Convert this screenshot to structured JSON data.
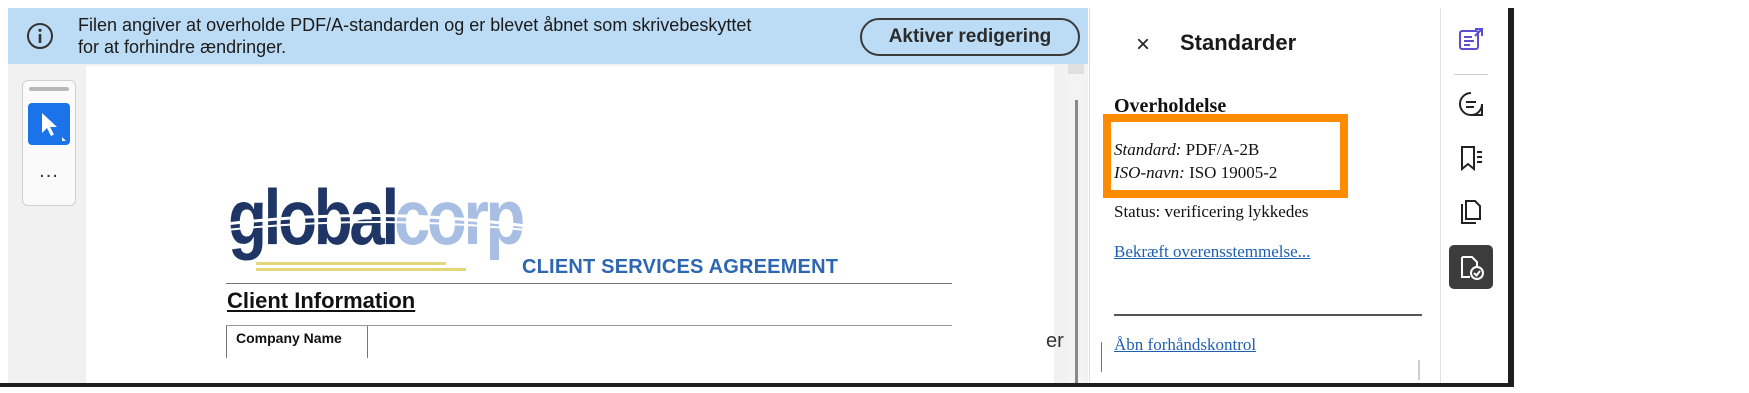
{
  "infobar": {
    "message_line1": "Filen angiver at overholde PDF/A-standarden og er blevet åbnet som skrivebeskyttet",
    "message_line2": "for at forhindre ændringer.",
    "enable_editing_label": "Aktiver redigering"
  },
  "tools": {
    "more_label": "..."
  },
  "document": {
    "logo_text_global": "global",
    "logo_text_corp": "corp",
    "agreement_title": "CLIENT SERVICES AGREEMENT",
    "section_heading": "Client Information",
    "company_name_label": "Company Name",
    "clipped_text": "er"
  },
  "panel": {
    "close_label": "×",
    "title": "Standarder",
    "compliance_heading": "Overholdelse",
    "standard_key": "Standard:",
    "standard_value": "PDF/A-2B",
    "iso_key": "ISO-navn:",
    "iso_value": "ISO 19005-2",
    "status_text": "Status: verificering lykkedes",
    "confirm_link": "Bekræft overensstemmelse...",
    "preflight_link": "Åbn forhåndskontrol",
    "highlight_color": "#ff8c00"
  },
  "rail": {
    "icons": [
      "edit-pdf-icon",
      "comment-icon",
      "bookmarks-icon",
      "pages-icon",
      "standards-icon"
    ],
    "active_icon": "standards-icon",
    "accent_color": "#5b4fcf"
  }
}
